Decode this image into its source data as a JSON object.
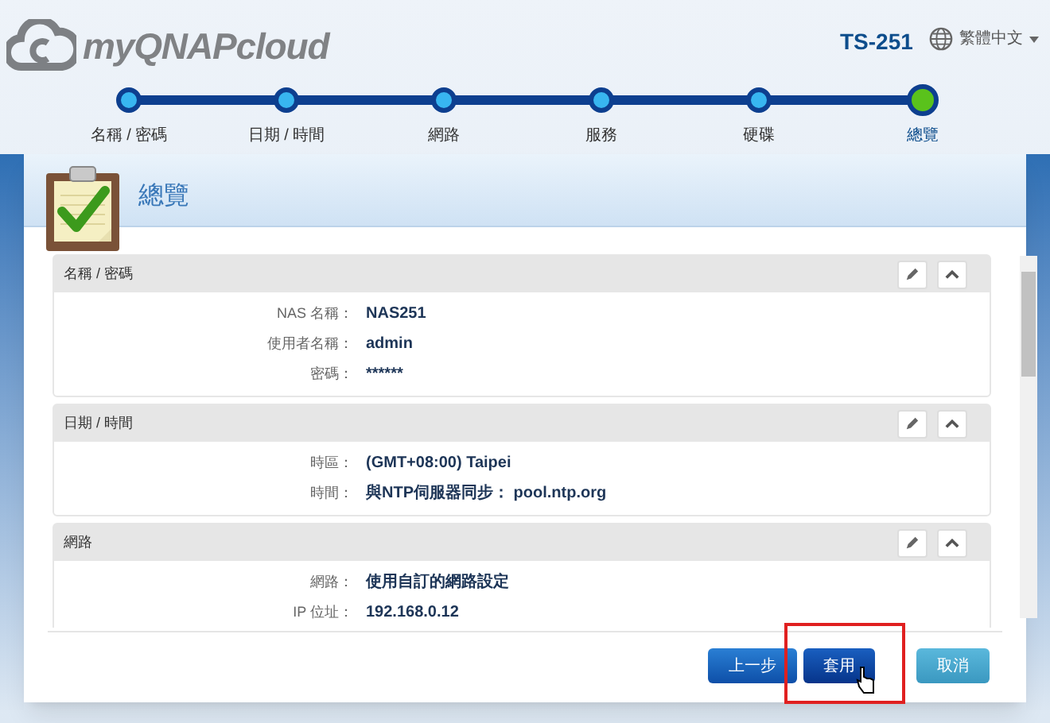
{
  "header": {
    "logo": "myQNAPcloud",
    "device": "TS-251",
    "language": "繁體中文"
  },
  "steps": [
    {
      "label": "名稱 / 密碼",
      "selected": false
    },
    {
      "label": "日期 / 時間",
      "selected": false
    },
    {
      "label": "網路",
      "selected": false
    },
    {
      "label": "服務",
      "selected": false
    },
    {
      "label": "硬碟",
      "selected": false
    },
    {
      "label": "總覽",
      "selected": true
    }
  ],
  "panel": {
    "title": "總覽"
  },
  "sections": [
    {
      "title": "名稱 / 密碼",
      "rows": [
        {
          "label": "NAS 名稱：",
          "value": "NAS251"
        },
        {
          "label": "使用者名稱：",
          "value": "admin"
        },
        {
          "label": "密碼：",
          "value": "******"
        }
      ]
    },
    {
      "title": "日期 / 時間",
      "rows": [
        {
          "label": "時區：",
          "value": "(GMT+08:00) Taipei"
        },
        {
          "label": "時間：",
          "value": "與NTP伺服器同步： pool.ntp.org"
        }
      ]
    },
    {
      "title": "網路",
      "rows": [
        {
          "label": "網路：",
          "value": "使用自訂的網路設定"
        },
        {
          "label": "IP 位址：",
          "value": "192.168.0.12"
        }
      ]
    }
  ],
  "buttons": [
    {
      "label": "上一步",
      "kind": "back"
    },
    {
      "label": "套用",
      "kind": "apply"
    },
    {
      "label": "取消",
      "kind": "cancel"
    }
  ]
}
